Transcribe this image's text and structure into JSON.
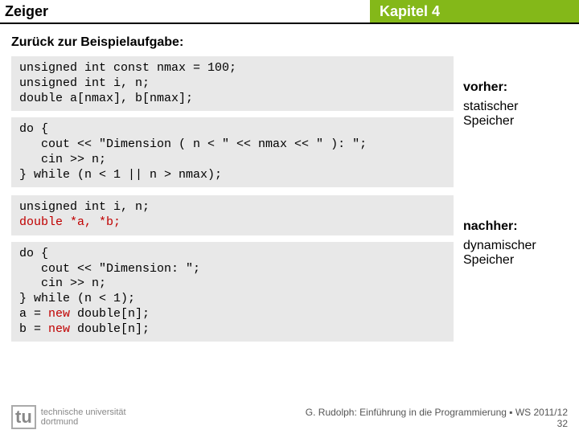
{
  "header": {
    "left": "Zeiger",
    "right": "Kapitel 4"
  },
  "subtitle": "Zurück zur Beispielaufgabe:",
  "code1a": "unsigned int const nmax = 100;\nunsigned int i, n;\ndouble a[nmax], b[nmax];",
  "code1b": "do {\n   cout << \"Dimension ( n < \" << nmax << \" ): \";\n   cin >> n;\n} while (n < 1 || n > nmax);",
  "side1_label": "vorher:",
  "side1_text": "statischer Speicher",
  "code2a_1": "unsigned int i, n;\n",
  "code2a_2": "double *a, *b;",
  "code2b_1": "do {\n   cout << \"Dimension: \";\n   cin >> n;\n} while (n < 1);\na = ",
  "code2b_2": "new",
  "code2b_3": " double[n];\nb = ",
  "code2b_4": "new",
  "code2b_5": " double[n];",
  "side2_label": "nachher:",
  "side2_text": "dynamischer Speicher",
  "footer": {
    "uni1": "technische universität",
    "uni2": "dortmund",
    "credit": "G. Rudolph: Einführung in die Programmierung ▪ WS 2011/12",
    "page": "32"
  }
}
